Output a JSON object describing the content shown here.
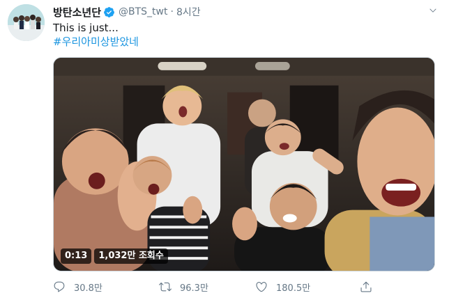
{
  "tweet": {
    "display_name": "방탄소년단",
    "handle": "@BTS_twt",
    "dot": "·",
    "time": "8시간",
    "text": "This is just...",
    "hashtag": "#우리아미상받았네",
    "video": {
      "duration": "0:13",
      "views": "1,032만 조회수"
    },
    "actions": {
      "replies": "30.8만",
      "retweets": "96.3만",
      "likes": "180.5만"
    }
  },
  "colors": {
    "link": "#1b95e0",
    "verified": "#1da1f2",
    "muted": "#657786"
  },
  "icons": {
    "verified": "verified-badge-icon",
    "caret": "chevron-down-icon",
    "reply": "reply-icon",
    "retweet": "retweet-icon",
    "like": "heart-icon",
    "share": "share-icon"
  }
}
